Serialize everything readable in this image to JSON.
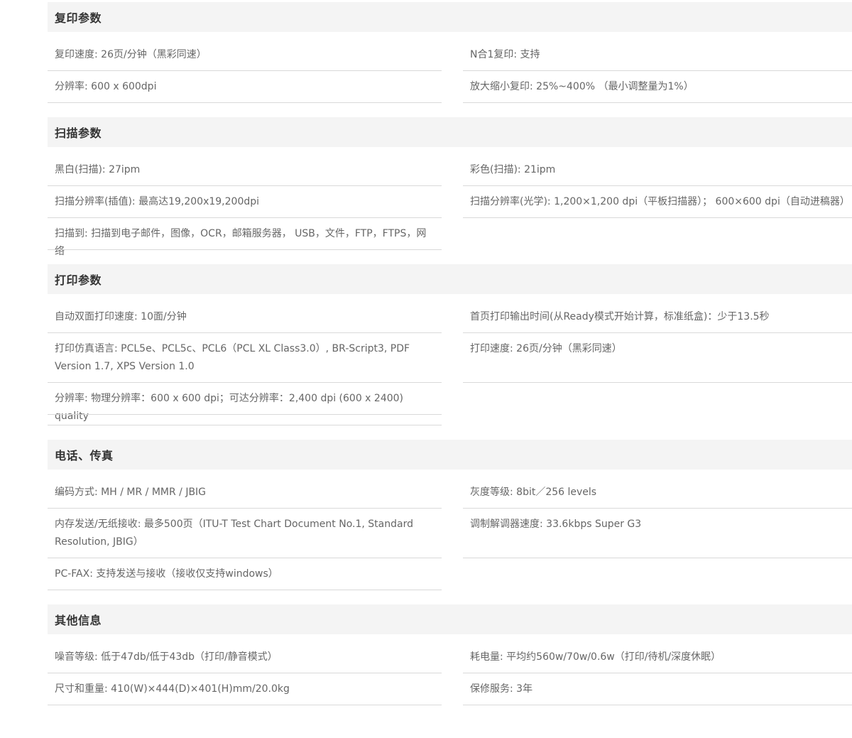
{
  "sections": {
    "copy": {
      "title": "复印参数",
      "left": [
        "复印速度: 26页/分钟（黑彩同速）",
        "分辨率: 600 x 600dpi"
      ],
      "right": [
        "N合1复印: 支持",
        "放大缩小复印: 25%~400% （最小调整量为1%）"
      ]
    },
    "scan": {
      "title": "扫描参数",
      "left": [
        "黑白(扫描): 27ipm",
        "扫描分辨率(插值): 最高达19,200x19,200dpi",
        "扫描到: 扫描到电子邮件，图像，OCR，邮箱服务器， USB，文件，FTP，FTPS，网络"
      ],
      "right": [
        "彩色(扫描): 21ipm",
        "扫描分辨率(光学): 1,200×1,200 dpi（平板扫描器）； 600×600 dpi（自动进稿器）"
      ]
    },
    "print": {
      "title": "打印参数",
      "left": [
        "自动双面打印速度: 10面/分钟",
        "打印仿真语言: PCL5e、PCL5c、PCL6（PCL XL Class3.0）, BR-Script3, PDF Version 1.7, XPS Version 1.0",
        "分辨率: 物理分辨率：600 x 600 dpi；可达分辨率：2,400 dpi (600 x 2400) quality"
      ],
      "right": [
        "首页打印输出时间(从Ready模式开始计算，标准纸盒)：少于13.5秒",
        "打印速度: 26页/分钟（黑彩同速）"
      ]
    },
    "fax": {
      "title": "电话、传真",
      "left": [
        "编码方式: MH / MR / MMR / JBIG",
        "内存发送/无纸接收: 最多500页（ITU-T Test Chart Document No.1, Standard Resolution, JBIG）",
        "PC-FAX: 支持发送与接收（接收仅支持windows）"
      ],
      "right": [
        "灰度等级: 8bit／256 levels",
        "调制解调器速度: 33.6kbps Super G3"
      ]
    },
    "other": {
      "title": "其他信息",
      "left": [
        "噪音等级: 低于47db/低于43db（打印/静音模式）",
        "尺寸和重量: 410(W)×444(D)×401(H)mm/20.0kg"
      ],
      "right": [
        "耗电量: 平均约560w/70w/0.6w（打印/待机/深度休眠）",
        "保修服务: 3年"
      ]
    }
  }
}
